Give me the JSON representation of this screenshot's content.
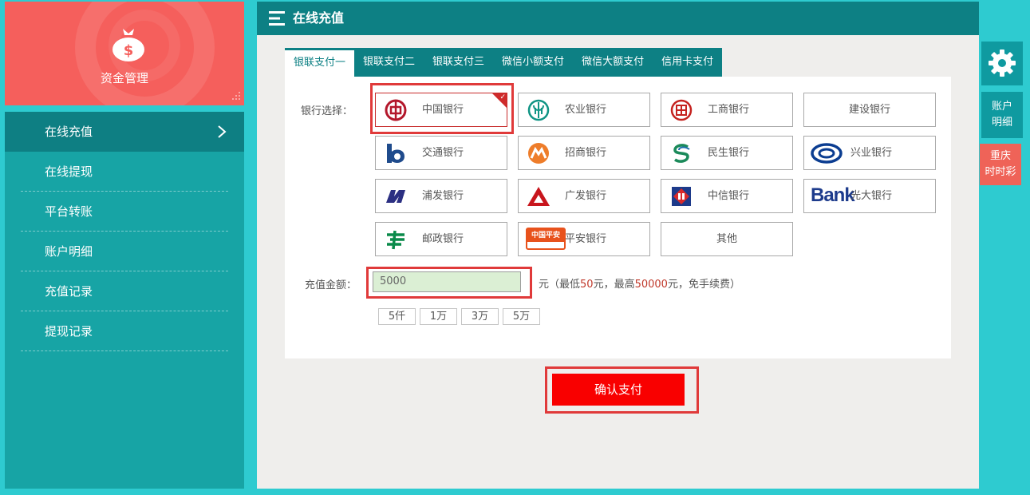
{
  "sidebar": {
    "brand_title": "资金管理",
    "items": [
      {
        "label": "在线充值",
        "active": true
      },
      {
        "label": "在线提现",
        "active": false
      },
      {
        "label": "平台转账",
        "active": false
      },
      {
        "label": "账户明细",
        "active": false
      },
      {
        "label": "充值记录",
        "active": false
      },
      {
        "label": "提现记录",
        "active": false
      }
    ]
  },
  "panel": {
    "title": "在线充值",
    "tabs": [
      {
        "label": "银联支付一",
        "active": true
      },
      {
        "label": "银联支付二",
        "active": false
      },
      {
        "label": "银联支付三",
        "active": false
      },
      {
        "label": "微信小额支付",
        "active": false
      },
      {
        "label": "微信大额支付",
        "active": false
      },
      {
        "label": "信用卡支付",
        "active": false
      }
    ],
    "bank_label": "银行选择：",
    "banks": [
      {
        "name": "中国银行",
        "icon": "boc-icon",
        "selected": true
      },
      {
        "name": "农业银行",
        "icon": "abc-icon",
        "selected": false
      },
      {
        "name": "工商银行",
        "icon": "icbc-icon",
        "selected": false
      },
      {
        "name": "建设银行",
        "icon": "",
        "selected": false
      },
      {
        "name": "交通银行",
        "icon": "bocom-icon",
        "selected": false
      },
      {
        "name": "招商银行",
        "icon": "cmb-icon",
        "selected": false
      },
      {
        "name": "民生银行",
        "icon": "cmbc-icon",
        "selected": false
      },
      {
        "name": "兴业银行",
        "icon": "cib-icon",
        "selected": false
      },
      {
        "name": "浦发银行",
        "icon": "spdb-icon",
        "selected": false
      },
      {
        "name": "广发银行",
        "icon": "cgb-icon",
        "selected": false
      },
      {
        "name": "中信银行",
        "icon": "citic-icon",
        "selected": false
      },
      {
        "name": "光大银行",
        "icon": "ceb-icon",
        "selected": false
      },
      {
        "name": "邮政银行",
        "icon": "psbc-icon",
        "selected": false
      },
      {
        "name": "平安银行",
        "icon": "pingan-icon",
        "selected": false
      },
      {
        "name": "其他",
        "icon": "",
        "selected": false
      }
    ],
    "ceb_logo_text": "Bank",
    "pingan_logo_text": "中国平安",
    "amount_label": "充值金额：",
    "amount_value": "5000",
    "hint_prefix": "元（最低",
    "hint_min": "50",
    "hint_mid": "元，最高",
    "hint_max": "50000",
    "hint_suffix": "元，免手续费）",
    "quick_amounts": [
      "5仟",
      "1万",
      "3万",
      "5万"
    ],
    "confirm_label": "确认支付"
  },
  "right_strip": {
    "gear_icon": "gear-icon",
    "account_detail": "账户明细",
    "account_detail_line1": "账户",
    "account_detail_line2": "明细",
    "lottery_line1": "重庆",
    "lottery_line2": "时时彩"
  },
  "colors": {
    "page_bg": "#2ecbd0",
    "header_teal": "#0d8084",
    "brand_red": "#f55f5c",
    "confirm_red": "#f90000",
    "highlight_red": "#e03a3a"
  }
}
